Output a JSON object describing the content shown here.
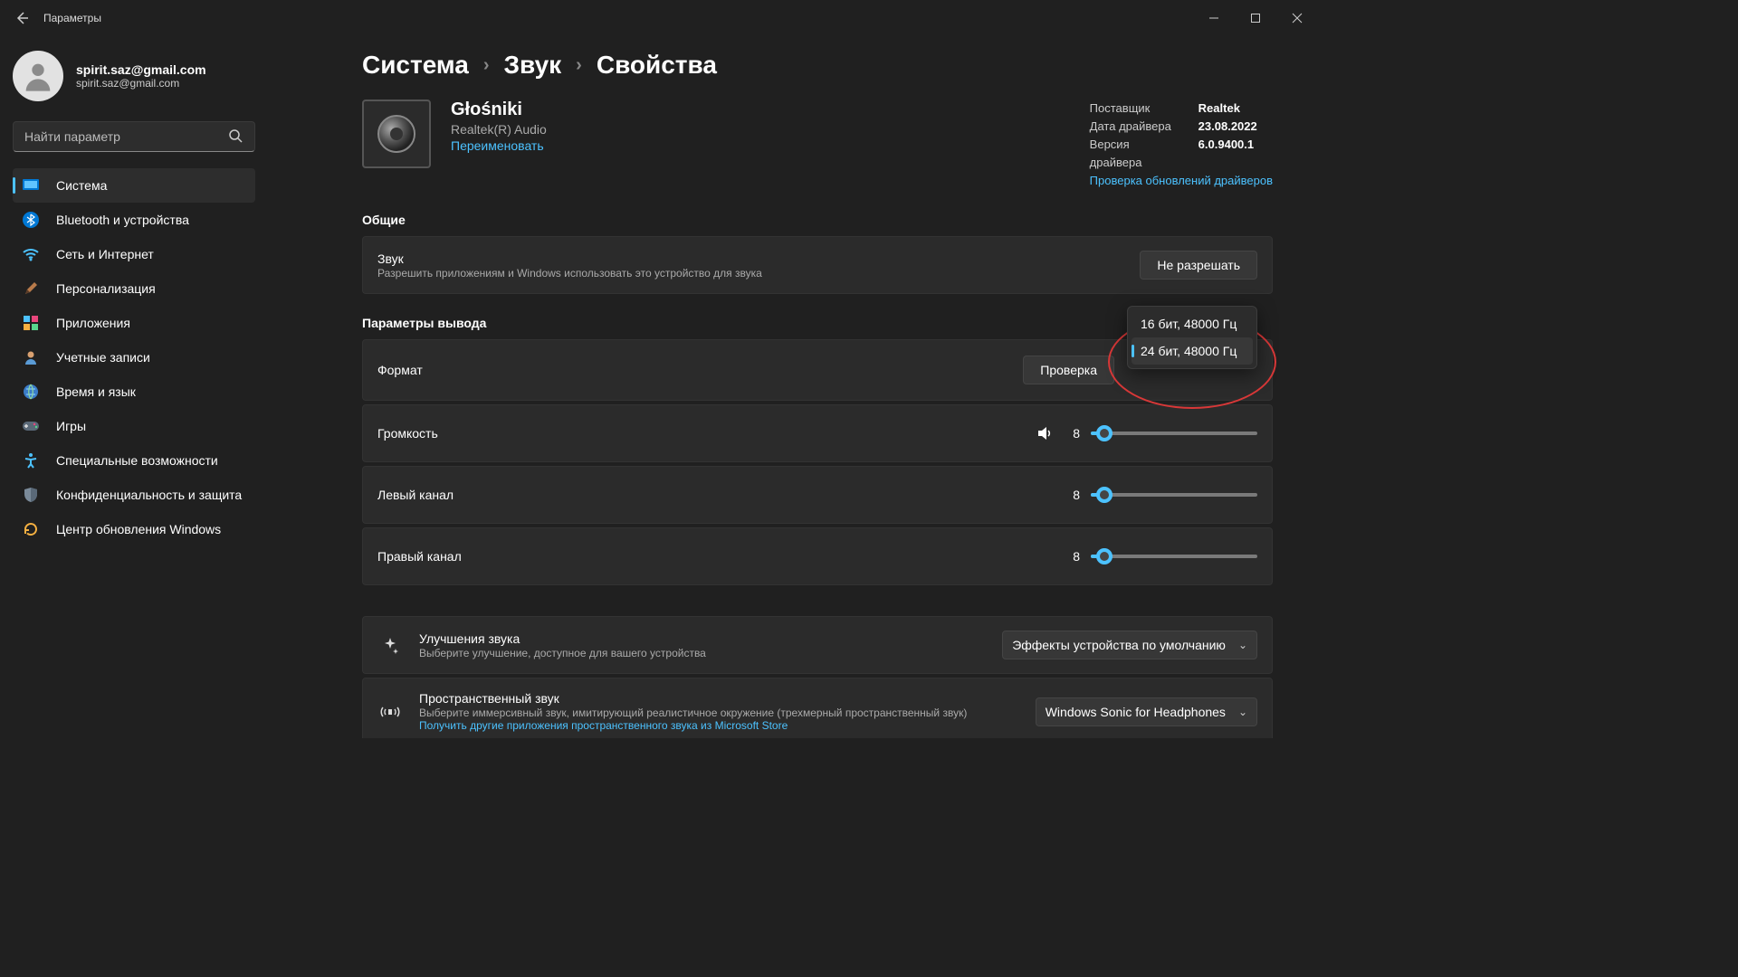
{
  "titlebar": {
    "title": "Параметры"
  },
  "account": {
    "name": "spirit.saz@gmail.com",
    "email": "spirit.saz@gmail.com"
  },
  "search": {
    "placeholder": "Найти параметр"
  },
  "nav": [
    {
      "label": "Система",
      "icon": "monitor",
      "active": true
    },
    {
      "label": "Bluetooth и устройства",
      "icon": "bluetooth"
    },
    {
      "label": "Сеть и Интернет",
      "icon": "wifi"
    },
    {
      "label": "Персонализация",
      "icon": "brush"
    },
    {
      "label": "Приложения",
      "icon": "apps"
    },
    {
      "label": "Учетные записи",
      "icon": "person"
    },
    {
      "label": "Время и язык",
      "icon": "globe"
    },
    {
      "label": "Игры",
      "icon": "game"
    },
    {
      "label": "Специальные возможности",
      "icon": "accessibility"
    },
    {
      "label": "Конфиденциальность и защита",
      "icon": "shield"
    },
    {
      "label": "Центр обновления Windows",
      "icon": "update"
    }
  ],
  "breadcrumb": [
    "Система",
    "Звук",
    "Свойства"
  ],
  "device": {
    "name": "Głośniki",
    "sub": "Realtek(R) Audio",
    "rename": "Переименовать"
  },
  "driver": {
    "vendor_label": "Поставщик",
    "vendor": "Realtek",
    "date_label": "Дата драйвера",
    "date": "23.08.2022",
    "ver_label": "Версия драйвера",
    "ver": "6.0.9400.1",
    "check": "Проверка обновлений драйверов"
  },
  "sections": {
    "general": "Общие",
    "output": "Параметры вывода"
  },
  "general_card": {
    "title": "Звук",
    "desc": "Разрешить приложениям и Windows использовать это устройство для звука",
    "button": "Не разрешать"
  },
  "format_card": {
    "title": "Формат",
    "test": "Проверка",
    "options": [
      "16 бит, 48000 Гц",
      "24 бит, 48000 Гц"
    ],
    "selected": "24 бит, 48000 Гц"
  },
  "volume": {
    "title": "Громкость",
    "value": "8",
    "percent": 8
  },
  "left": {
    "title": "Левый канал",
    "value": "8",
    "percent": 8
  },
  "right": {
    "title": "Правый канал",
    "value": "8",
    "percent": 8
  },
  "enhance": {
    "title": "Улучшения звука",
    "desc": "Выберите улучшение, доступное для вашего устройства",
    "select": "Эффекты устройства по умолчанию"
  },
  "spatial": {
    "title": "Пространственный звук",
    "desc": "Выберите иммерсивный звук, имитирующий реалистичное окружение (трехмерный пространственный звук)",
    "link": "Получить другие приложения пространственного звука из Microsoft Store",
    "select": "Windows Sonic for Headphones"
  }
}
